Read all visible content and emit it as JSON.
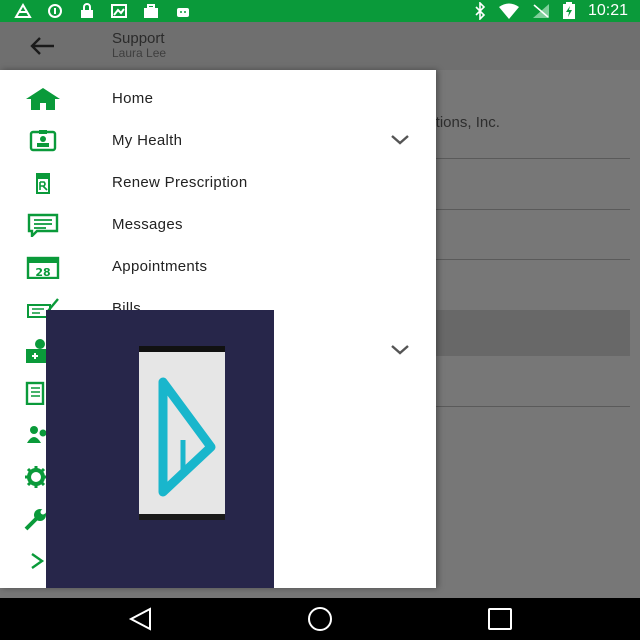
{
  "status_bar": {
    "time": "10:21",
    "color": "#0a9a3a",
    "left_icons": [
      "signal-icon",
      "info-icon",
      "lock-icon",
      "image-icon",
      "briefcase-icon",
      "android-icon"
    ],
    "right_icons": [
      "bluetooth-icon",
      "wifi-icon",
      "no-signal-icon",
      "battery-icon"
    ]
  },
  "app_bar": {
    "title": "Support",
    "subtitle": "Laura Lee",
    "back_icon": "back-arrow-icon"
  },
  "background": {
    "company_text": "lutions, Inc."
  },
  "drawer": {
    "accent_color": "#0a9a3a",
    "items": [
      {
        "label": "Home",
        "icon": "home-icon"
      },
      {
        "label": "My Health",
        "icon": "id-card-icon",
        "expandable": true
      },
      {
        "label": "Renew Prescription",
        "icon": "prescription-icon"
      },
      {
        "label": "Messages",
        "icon": "message-icon"
      },
      {
        "label": "Appointments",
        "icon": "calendar-icon",
        "icon_text": "28"
      },
      {
        "label": "Bills",
        "icon": "bill-icon"
      }
    ],
    "partial_icons": [
      "medical-bag-icon",
      "notebook-icon",
      "people-icon",
      "gear-icon",
      "wrench-icon",
      "arrow-right-icon"
    ]
  },
  "overlay": {
    "logo": "app-logo-triangle-icon",
    "background_color": "#27264a"
  },
  "nav_bar": {
    "buttons": [
      "back-nav-icon",
      "home-nav-icon",
      "recents-nav-icon"
    ]
  }
}
